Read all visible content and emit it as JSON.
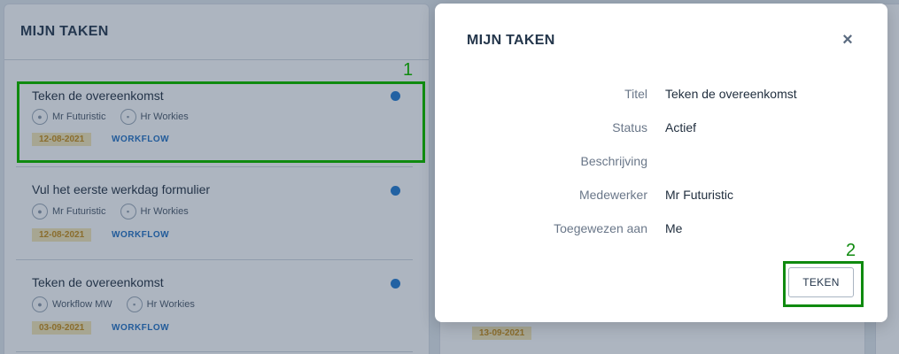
{
  "background": {
    "left_panel_title": "MIJN TAKEN",
    "tasks": [
      {
        "title": "Teken de overeenkomst",
        "employee": "Mr Futuristic",
        "assigner": "Hr Workies",
        "date": "12-08-2021",
        "tag": "WORKFLOW"
      },
      {
        "title": "Vul het eerste werkdag formulier",
        "employee": "Mr Futuristic",
        "assigner": "Hr Workies",
        "date": "12-08-2021",
        "tag": "WORKFLOW"
      },
      {
        "title": "Teken de overeenkomst",
        "employee": "Workflow MW",
        "assigner": "Hr Workies",
        "date": "03-09-2021",
        "tag": "WORKFLOW"
      }
    ],
    "right_panel_date": "13-09-2021"
  },
  "modal": {
    "title": "MIJN TAKEN",
    "close_icon": "×",
    "fields": [
      {
        "label": "Titel",
        "value": "Teken de overeenkomst"
      },
      {
        "label": "Status",
        "value": "Actief"
      },
      {
        "label": "Beschrijving",
        "value": ""
      },
      {
        "label": "Medewerker",
        "value": "Mr Futuristic"
      },
      {
        "label": "Toegewezen aan",
        "value": "Me"
      }
    ],
    "sign_button": "TEKEN"
  },
  "annotations": {
    "label_1": "1",
    "label_2": "2"
  },
  "colors": {
    "annotation_green": "#0f8a0f",
    "status_dot_blue": "#1f7ad1",
    "date_badge_bg": "#f6e7b5",
    "date_badge_text": "#c78b12",
    "tag_blue": "#1f6fc2"
  }
}
